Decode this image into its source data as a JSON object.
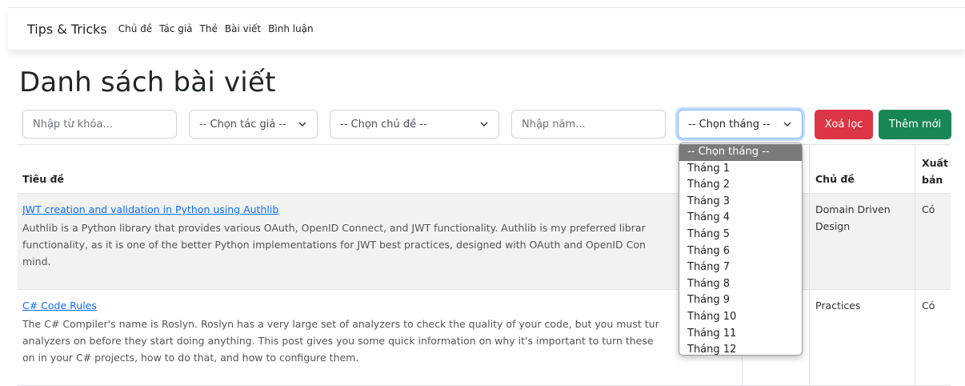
{
  "navbar": {
    "brand": "Tips & Tricks",
    "links": [
      "Chủ đề",
      "Tác giả",
      "Thẻ",
      "Bài viết",
      "Bình luận"
    ]
  },
  "page_title": "Danh sách bài viết",
  "filters": {
    "keyword_placeholder": "Nhập từ khóa...",
    "author_select": "-- Chọn tác giả --",
    "topic_select": "-- Chọn chủ đề --",
    "year_placeholder": "Nhập năm...",
    "month_select": "-- Chọn tháng --",
    "clear_button": "Xoá lọc",
    "add_button": "Thêm mới"
  },
  "table": {
    "headers": {
      "title": "Tiêu đề",
      "topic": "Chủ đề",
      "published": "Xuất bản"
    },
    "rows": [
      {
        "title": "JWT creation and validation in Python using Authlib",
        "excerpt_lines": [
          "Authlib is a Python library that provides various OAuth, OpenID Connect, and JWT functionality. Authlib is my preferred librar",
          "functionality, as it is one of the better Python implementations for JWT best practices, designed with OAuth and OpenID Con",
          "mind."
        ],
        "topic_lines": [
          "Domain Driven",
          "Design"
        ],
        "published": "Có"
      },
      {
        "title": "C# Code Rules",
        "excerpt_lines": [
          "The C# Compiler's name is Roslyn. Roslyn has a very large set of analyzers to check the quality of your code, but you must tur",
          "analyzers on before they start doing anything. This post gives you some quick information on why it's important to turn these",
          "on in your C# projects, how to do that, and how to configure them."
        ],
        "topic_lines": [
          "Practices"
        ],
        "published": "Có"
      }
    ]
  },
  "month_dropdown": {
    "options": [
      "-- Chọn tháng --",
      "Tháng 1",
      "Tháng 2",
      "Tháng 3",
      "Tháng 4",
      "Tháng 5",
      "Tháng 6",
      "Tháng 7",
      "Tháng 8",
      "Tháng 9",
      "Tháng 10",
      "Tháng 11",
      "Tháng 12"
    ],
    "selected": "-- Chọn tháng --"
  },
  "icons": {
    "select_arrow": "chevron-down-icon"
  },
  "colors": {
    "danger": "#dc3545",
    "success": "#198754",
    "link": "#0d6efd",
    "focus": "#86b7fe"
  }
}
